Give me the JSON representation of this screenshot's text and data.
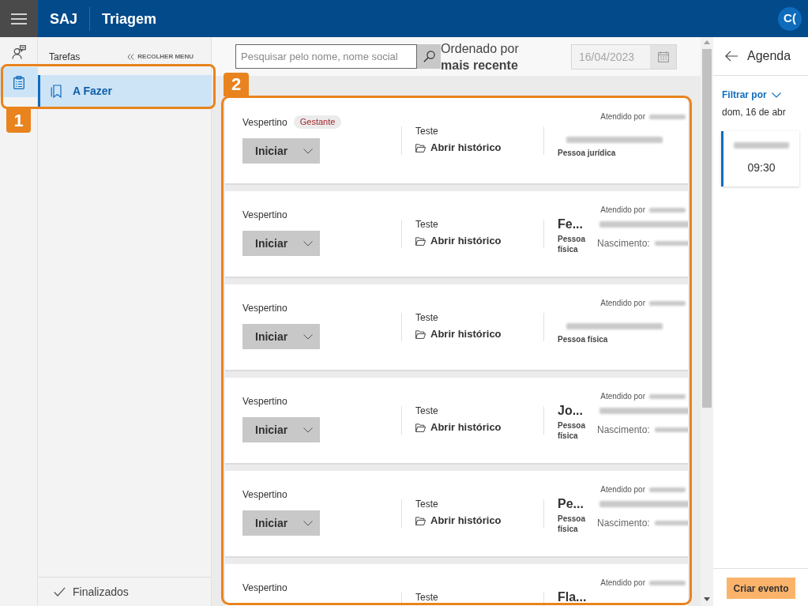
{
  "header": {
    "app_name": "SAJ",
    "title": "Triagem",
    "avatar": "C("
  },
  "rail": [
    {
      "kind": "contacts",
      "selected": false
    },
    {
      "kind": "tasks",
      "selected": true
    }
  ],
  "sidebar": {
    "title": "Tarefas",
    "collapse": "RECOLHER MENU",
    "items": [
      {
        "label": "A Fazer",
        "selected": true
      }
    ],
    "footer": {
      "label": "Finalizados"
    }
  },
  "toolbar": {
    "search": {
      "placeholder": "Pesquisar pelo nome, nome social"
    },
    "sort": {
      "label": "Ordenado por",
      "value": "mais recente"
    },
    "date": {
      "value": "16/04/2023",
      "disabled": true
    }
  },
  "cards": [
    {
      "period": "Vespertino",
      "tag": "Gestante",
      "action": "Iniciar",
      "subject": "Teste",
      "history": "Abrir histórico",
      "attended": {
        "label": "Atendido por",
        "redacted": true
      },
      "person": {
        "document_redacted": true,
        "type": "Pessoa jurídica"
      }
    },
    {
      "period": "Vespertino",
      "action": "Iniciar",
      "subject": "Teste",
      "history": "Abrir histórico",
      "attended": {
        "label": "Atendido por",
        "redacted": true
      },
      "person": {
        "name": "Fe...",
        "document_redacted": true,
        "type": "Pessoa física",
        "birth": {
          "label": "Nascimento:",
          "redacted": true
        }
      }
    },
    {
      "period": "Vespertino",
      "action": "Iniciar",
      "subject": "Teste",
      "history": "Abrir histórico",
      "attended": {
        "label": "Atendido por",
        "redacted": true
      },
      "person": {
        "document_redacted": true,
        "type": "Pessoa física"
      }
    },
    {
      "period": "Vespertino",
      "action": "Iniciar",
      "subject": "Teste",
      "history": "Abrir histórico",
      "attended": {
        "label": "Atendido por",
        "redacted": true
      },
      "person": {
        "name": "Jo...",
        "document_redacted": true,
        "type": "Pessoa física",
        "birth": {
          "label": "Nascimento:",
          "redacted": true
        }
      }
    },
    {
      "period": "Vespertino",
      "action": "Iniciar",
      "subject": "Teste",
      "history": "Abrir histórico",
      "attended": {
        "label": "Atendido por",
        "redacted": true
      },
      "person": {
        "name": "Pe...",
        "document_redacted": true,
        "type": "Pessoa física",
        "birth": {
          "label": "Nascimento:",
          "redacted": true
        }
      }
    },
    {
      "period": "Vespertino",
      "subject": "Teste",
      "attended": {
        "label": "Atendido por",
        "redacted": true
      },
      "person": {
        "name": "Fla..."
      }
    }
  ],
  "agenda": {
    "title": "Agenda",
    "filter": "Filtrar por",
    "date": "dom, 16 de abr",
    "events": [
      {
        "title_redacted": true,
        "time": "09:30"
      }
    ],
    "create_button": "Criar evento"
  },
  "annotations": [
    {
      "label": "1"
    },
    {
      "label": "2"
    }
  ]
}
